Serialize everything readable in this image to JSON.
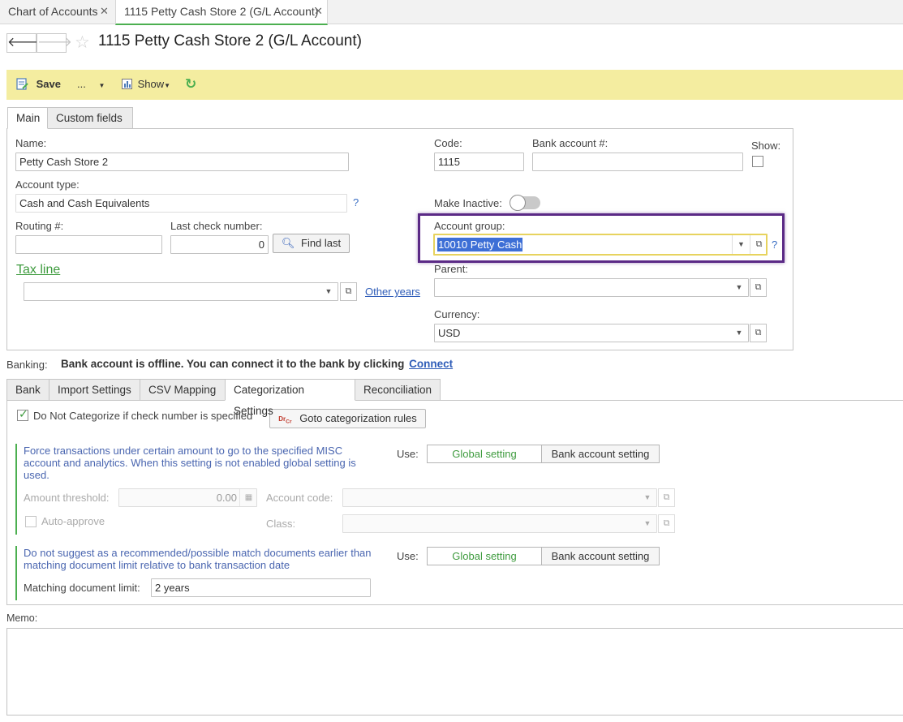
{
  "tabs": [
    {
      "label": "Chart of Accounts"
    },
    {
      "label": "1115 Petty Cash Store 2 (G/L Account)"
    }
  ],
  "page_title": "1115 Petty Cash Store 2 (G/L Account)",
  "toolbar": {
    "save": "Save",
    "more": "...",
    "show": "Show"
  },
  "form_tabs": {
    "main": "Main",
    "custom": "Custom fields"
  },
  "fields": {
    "name_label": "Name:",
    "name_value": "Petty Cash Store 2",
    "code_label": "Code:",
    "code_value": "1115",
    "bank_account_label": "Bank account #:",
    "bank_account_value": "",
    "show_label": "Show:",
    "account_type_label": "Account type:",
    "account_type_value": "Cash and Cash Equivalents",
    "make_inactive_label": "Make Inactive:",
    "routing_label": "Routing #:",
    "routing_value": "",
    "last_check_label": "Last check number:",
    "last_check_value": "0",
    "find_last": "Find last",
    "account_group_label": "Account group:",
    "account_group_value": "10010 Petty Cash",
    "tax_line_label": "Tax line",
    "tax_line_value": "",
    "other_years": "Other years",
    "parent_label": "Parent:",
    "parent_value": "",
    "currency_label": "Currency:",
    "currency_value": "USD",
    "help": "?"
  },
  "banking": {
    "label": "Banking:",
    "message": "Bank account is offline. You can connect it to the bank by clicking",
    "connect": "Connect"
  },
  "bank_tabs": [
    "Bank",
    "Import Settings",
    "CSV Mapping",
    "Categorization Settings",
    "Reconciliation"
  ],
  "categorization": {
    "do_not_categorize": "Do Not Categorize if check number is specified",
    "goto_rules": "Goto categorization rules",
    "force_desc": "Force transactions under certain amount to go to the specified MISC account and analytics. When this setting is not enabled global setting is used.",
    "use_label": "Use:",
    "global_setting": "Global setting",
    "bank_account_setting": "Bank account setting",
    "amount_threshold_label": "Amount threshold:",
    "amount_threshold_value": "0.00",
    "account_code_label": "Account code:",
    "auto_approve": "Auto-approve",
    "class_label": "Class:",
    "match_desc": "Do not suggest as a recommended/possible match documents earlier than matching document limit relative to bank transaction date",
    "matching_limit_label": "Matching document limit:",
    "matching_limit_value": "2 years"
  },
  "memo_label": "Memo:",
  "memo_value": "",
  "colors": {
    "accent_green": "#4caf50",
    "highlight_purple": "#5b2a86",
    "toolbar_yellow": "#f4eda0"
  }
}
